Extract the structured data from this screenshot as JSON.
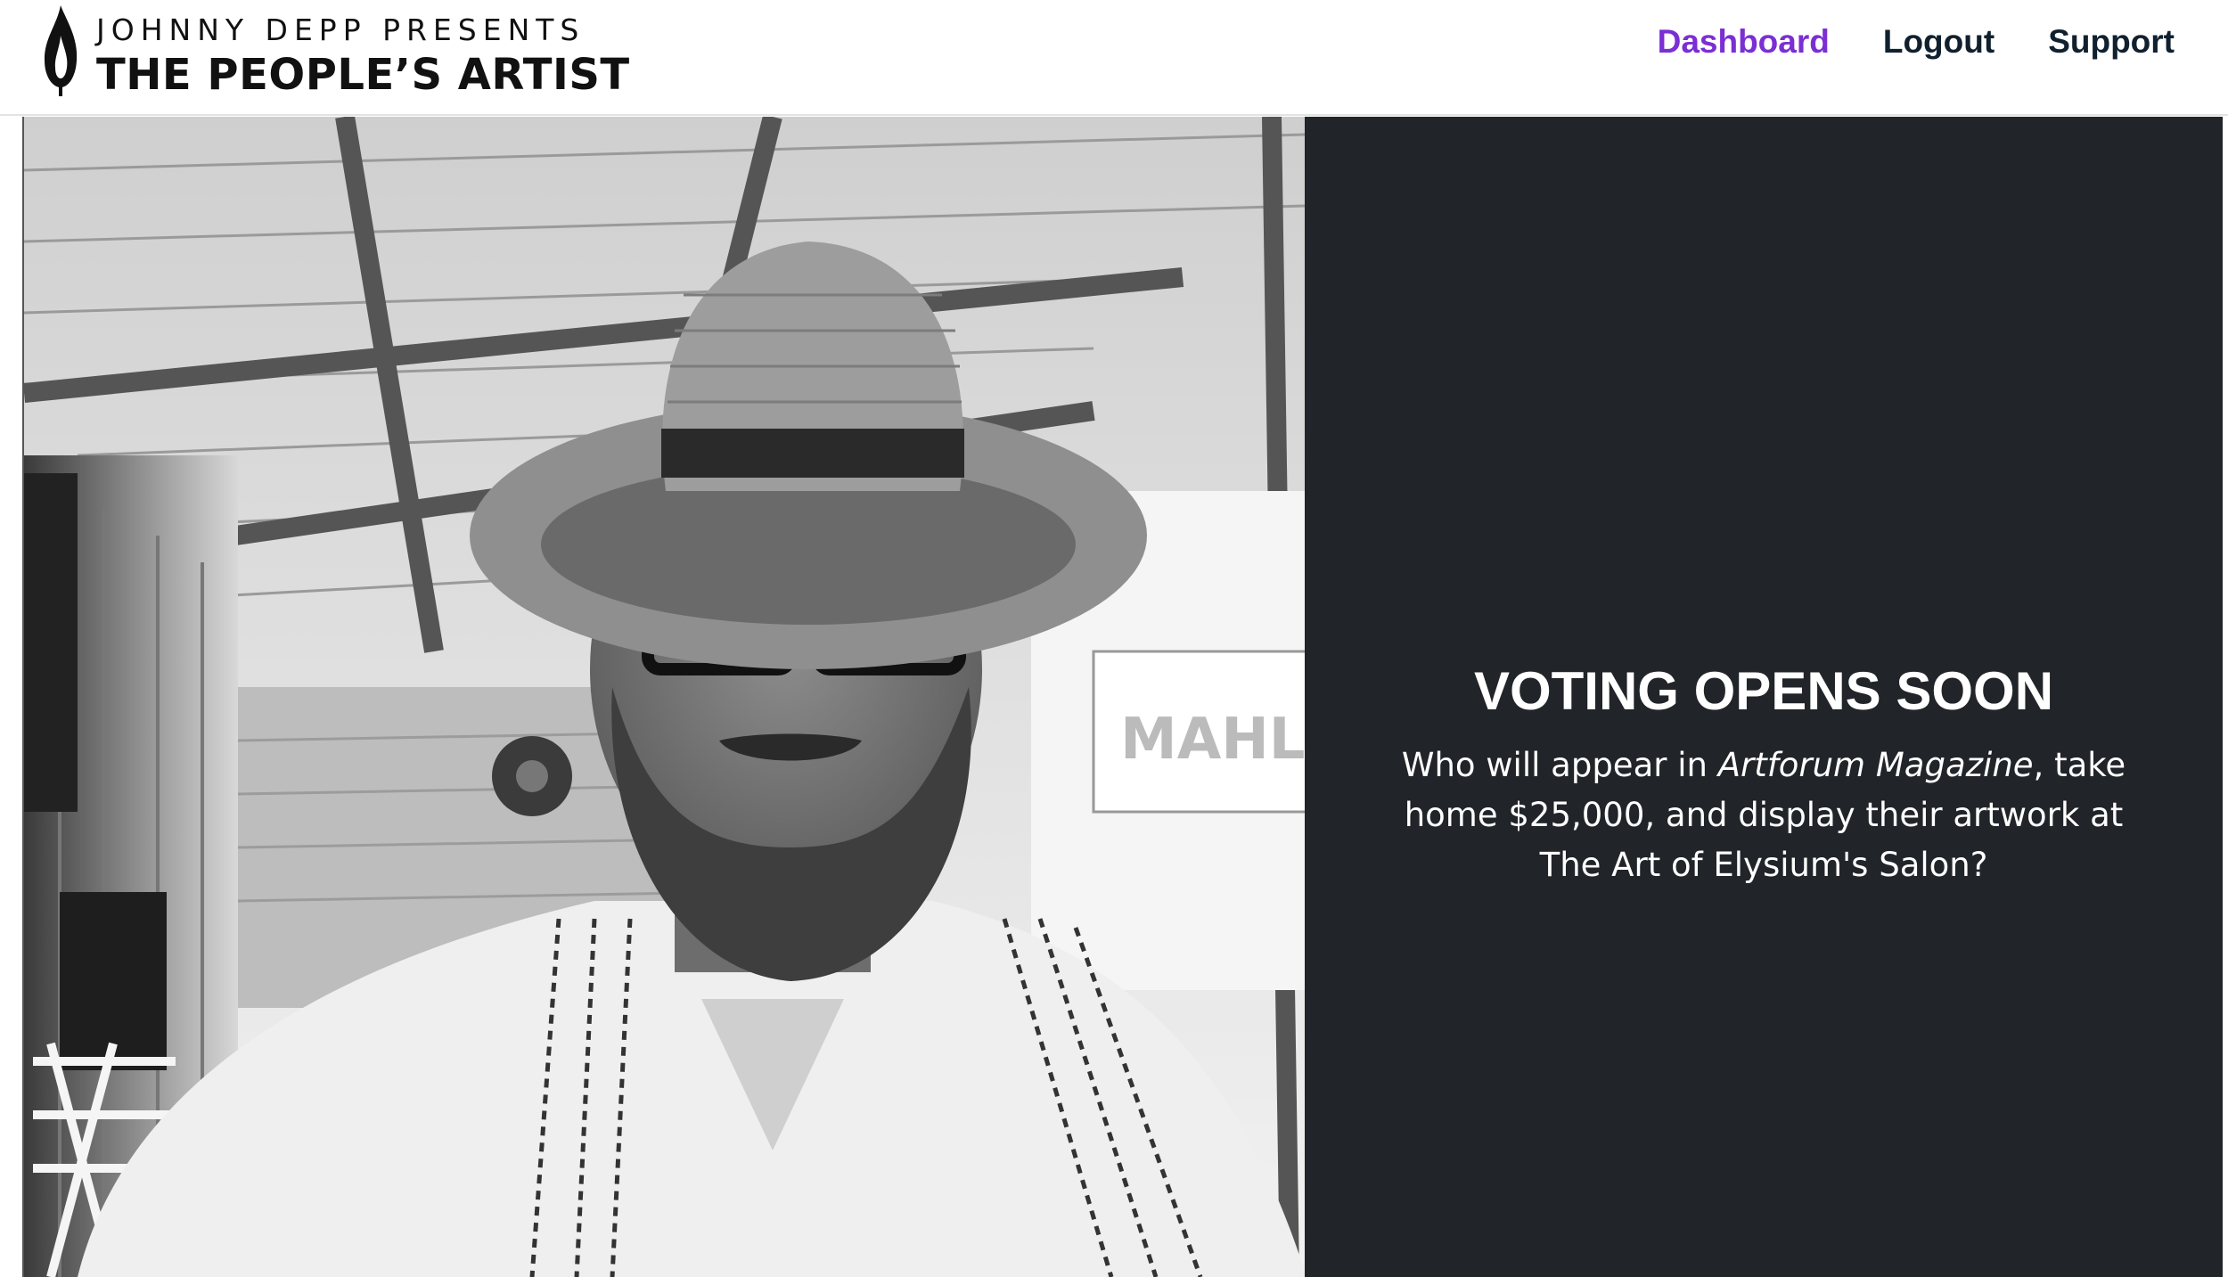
{
  "header": {
    "logo": {
      "line1": "JOHNNY DEPP PRESENTS",
      "line2": "THE PEOPLE’S ARTIST",
      "icon": "flame-icon"
    },
    "nav": {
      "dashboard": "Dashboard",
      "logout": "Logout",
      "support": "Support"
    },
    "active_nav": "Dashboard"
  },
  "hero": {
    "photo": {
      "subject": "artist-portrait",
      "style": "black-and-white"
    },
    "panel": {
      "heading": "VOTING OPENS SOON",
      "body_prefix": "Who will appear in ",
      "body_italic": "Artforum Magazine",
      "body_suffix": ", take home $25,000, and display their artwork at The Art of Elysium's Salon?"
    }
  },
  "colors": {
    "accent": "#7b2fd3",
    "nav_text": "#10202e",
    "panel_bg": "#212428",
    "panel_text": "#ffffff"
  }
}
